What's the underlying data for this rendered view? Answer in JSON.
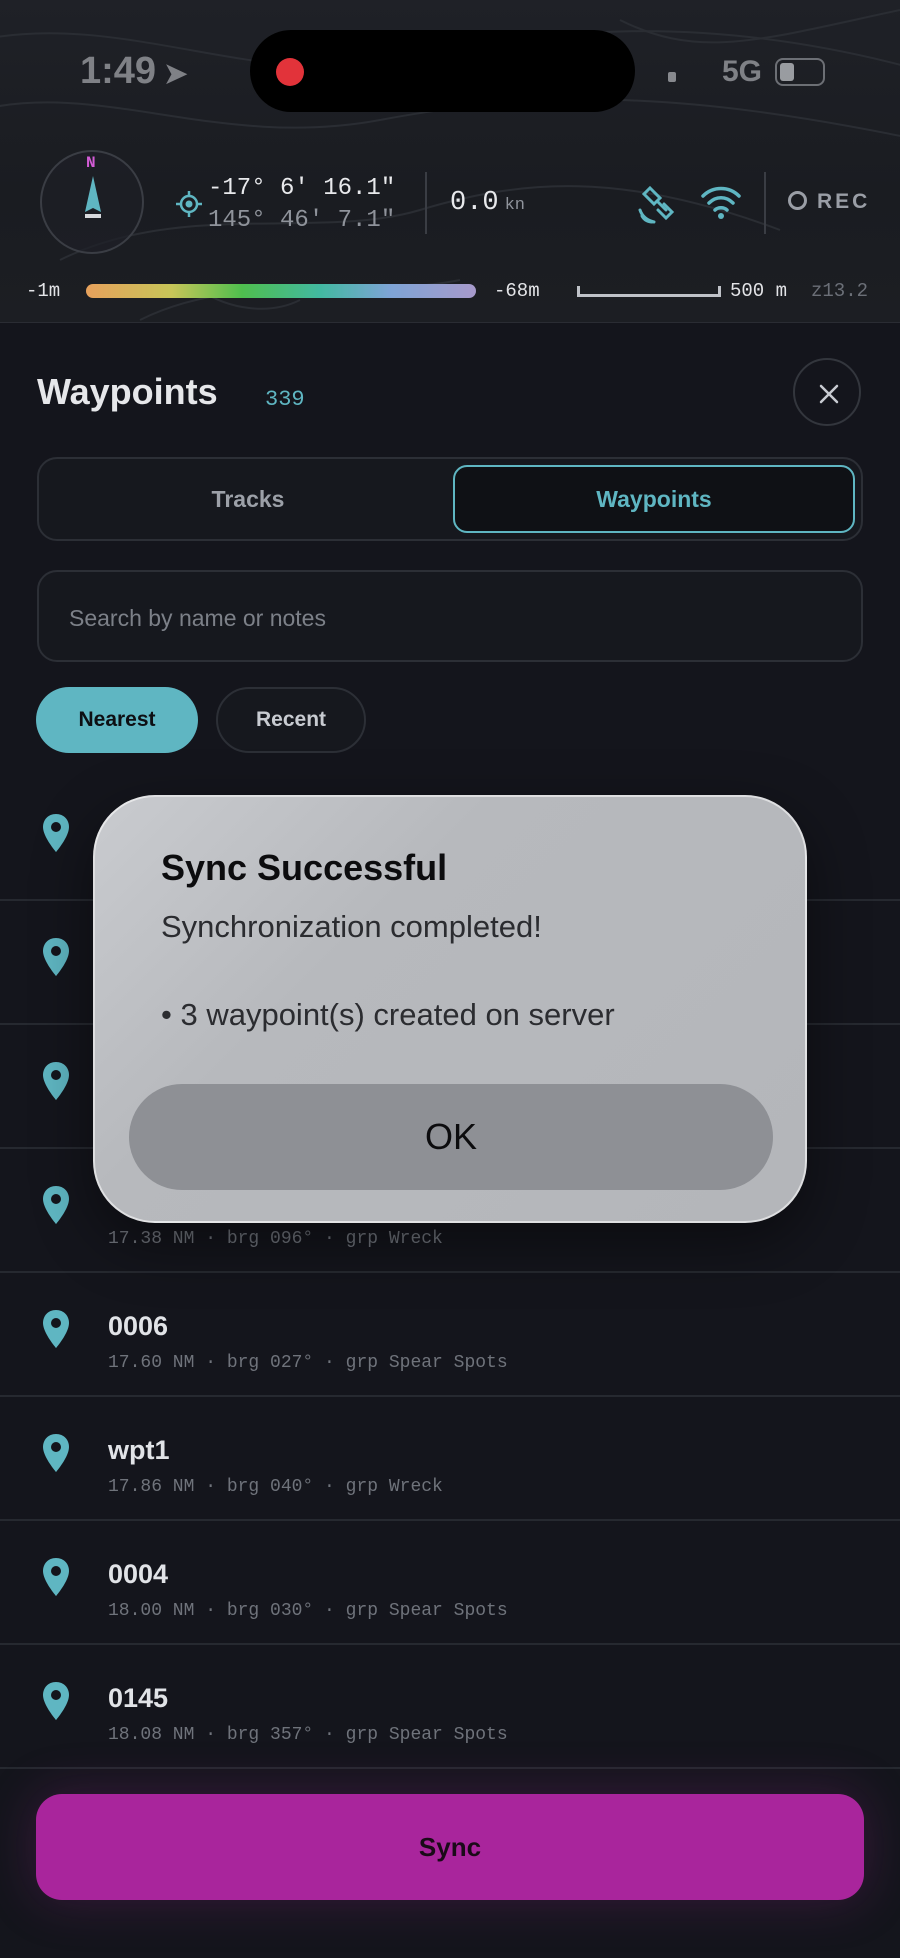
{
  "status_bar": {
    "time": "1:49",
    "network": "5G"
  },
  "nav_header": {
    "compass_label": "N",
    "latitude": "-17° 6' 16.1\"",
    "longitude": "145° 46' 7.1\"",
    "speed_value": "0.0",
    "speed_unit": "kn",
    "rec_label": "REC",
    "depth_min": "-1m",
    "depth_max": "-68m",
    "scale_label": "500 m",
    "zoom_label": "z13.2"
  },
  "panel": {
    "title": "Waypoints",
    "count": "339",
    "tabs": [
      {
        "label": "Tracks",
        "active": false
      },
      {
        "label": "Waypoints",
        "active": true
      }
    ],
    "search_placeholder": "Search by name or notes",
    "sort_chips": [
      {
        "label": "Nearest",
        "active": true
      },
      {
        "label": "Recent",
        "active": false
      }
    ],
    "waypoints": [
      {
        "name": "",
        "meta": ""
      },
      {
        "name": "",
        "meta": ""
      },
      {
        "name": "",
        "meta": ""
      },
      {
        "name": "",
        "meta": "17.38 NM · brg 096° · grp Wreck"
      },
      {
        "name": "0006",
        "meta": "17.60 NM · brg 027° · grp Spear Spots"
      },
      {
        "name": "wpt1",
        "meta": "17.86 NM · brg 040° · grp Wreck"
      },
      {
        "name": "0004",
        "meta": "18.00 NM · brg 030° · grp Spear Spots"
      },
      {
        "name": "0145",
        "meta": "18.08 NM · brg 357° · grp Spear Spots"
      }
    ],
    "sync_label": "Sync"
  },
  "alert": {
    "title": "Sync Successful",
    "message": "Synchronization completed!",
    "detail": "• 3 waypoint(s) created on server",
    "ok_label": "OK"
  },
  "colors": {
    "accent": "#5fb6c2",
    "sync_button": "#a9259c",
    "recording_dot": "#e2333a",
    "background": "#14151c"
  }
}
